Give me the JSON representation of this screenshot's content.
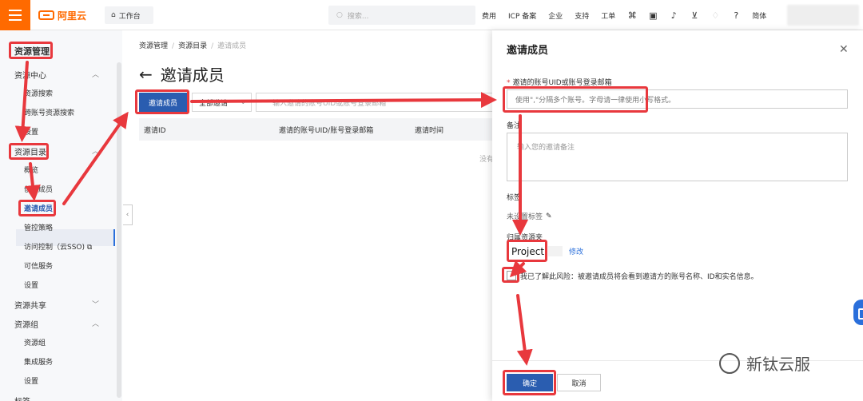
{
  "topbar": {
    "logo_text": "阿里云",
    "workbench": "工作台",
    "search_placeholder": "搜索...",
    "nav": [
      "费用",
      "ICP 备案",
      "企业",
      "支持",
      "工单"
    ],
    "lang": "简体"
  },
  "sidebar": {
    "title": "资源管理",
    "sections": {
      "resource_center": "资源中心",
      "resource_search": "资源搜索",
      "cross_account_search": "跨账号资源搜索",
      "settings1": "设置",
      "resource_directory": "资源目录",
      "overview": "概览",
      "create_member": "创建成员",
      "invite_member": "邀请成员",
      "control_policy": "管控策略",
      "access_control": "访问控制（云SSO)",
      "trusted_service": "可信服务",
      "settings2": "设置",
      "resource_share": "资源共享",
      "resource_group": "资源组",
      "resource_group_item": "资源组",
      "integration_service": "集成服务",
      "settings3": "设置",
      "tags": "标签"
    }
  },
  "main": {
    "breadcrumb": [
      "资源管理",
      "资源目录",
      "邀请成员"
    ],
    "title": "邀请成员",
    "invite_button": "邀请成员",
    "filter_select": "全部邀请",
    "filter_placeholder": "输入邀请的账号UID或账号登录邮箱",
    "columns": [
      "邀请ID",
      "邀请的账号UID/账号登录邮箱",
      "邀请时间"
    ],
    "empty": "没有"
  },
  "drawer": {
    "title": "邀请成员",
    "account_label": "邀请的账号UID或账号登录邮箱",
    "account_placeholder": "使用\",\"分隔多个账号。字母请一律使用小写格式。",
    "remark_label": "备注",
    "remark_placeholder": "输入您的邀请备注",
    "tag_label": "标签",
    "tag_value": "未设置标签",
    "folder_label": "归属资源夹",
    "folder_value": "Project",
    "folder_edit": "修改",
    "ack_text": "我已了解此风险：被邀请成员将会看到邀请方的账号名称、ID和实名信息。",
    "ok": "确定",
    "cancel": "取消"
  },
  "watermark": "新钛云服",
  "colors": {
    "brand": "#ff6a00",
    "primary": "#2a5db0",
    "annotation": "#e8383d"
  }
}
